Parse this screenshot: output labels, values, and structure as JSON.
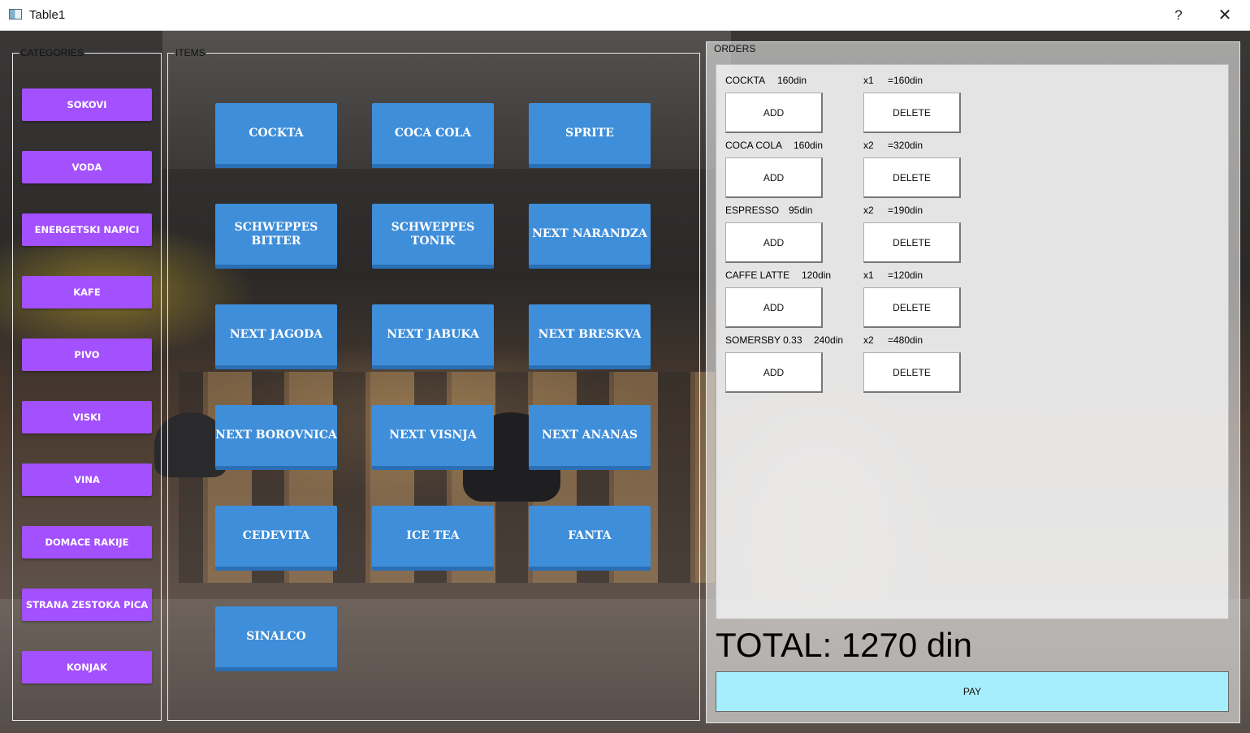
{
  "window": {
    "title": "Table1",
    "help_glyph": "?",
    "close_glyph": "✕"
  },
  "categories": {
    "legend": "CATEGORIES",
    "items": [
      "SOKOVI",
      "VODA",
      "ENERGETSKI NAPICI",
      "KAFE",
      "PIVO",
      "VISKI",
      "VINA",
      "DOMACE RAKIJE",
      "STRANA ZESTOKA PICA",
      "KONJAK"
    ]
  },
  "items": {
    "legend": "ITEMS",
    "list": [
      "COCKTA",
      "COCA COLA",
      "SPRITE",
      "SCHWEPPES BITTER",
      "SCHWEPPES TONIK",
      "NEXT NARANDZA",
      "NEXT JAGODA",
      "NEXT JABUKA",
      "NEXT BRESKVA",
      "NEXT BOROVNICA",
      "NEXT VISNJA",
      "NEXT ANANAS",
      "CEDEVITA",
      "ICE TEA",
      "FANTA",
      "SINALCO"
    ]
  },
  "orders": {
    "legend": "ORDERS",
    "add_label": "ADD",
    "delete_label": "DELETE",
    "rows": [
      {
        "name": "COCKTA",
        "price": "160din",
        "qty": "x1",
        "subtotal": "=160din"
      },
      {
        "name": "COCA COLA",
        "price": "160din",
        "qty": "x2",
        "subtotal": "=320din"
      },
      {
        "name": "ESPRESSO",
        "price": "95din",
        "qty": "x2",
        "subtotal": "=190din"
      },
      {
        "name": "CAFFE LATTE",
        "price": "120din",
        "qty": "x1",
        "subtotal": "=120din"
      },
      {
        "name": "SOMERSBY 0.33",
        "price": "240din",
        "qty": "x2",
        "subtotal": "=480din"
      }
    ],
    "total": "TOTAL: 1270 din",
    "pay_label": "PAY"
  },
  "colors": {
    "category_button": "#a350ff",
    "item_button": "#3f8ed9",
    "pay_button": "#a7eefc"
  }
}
